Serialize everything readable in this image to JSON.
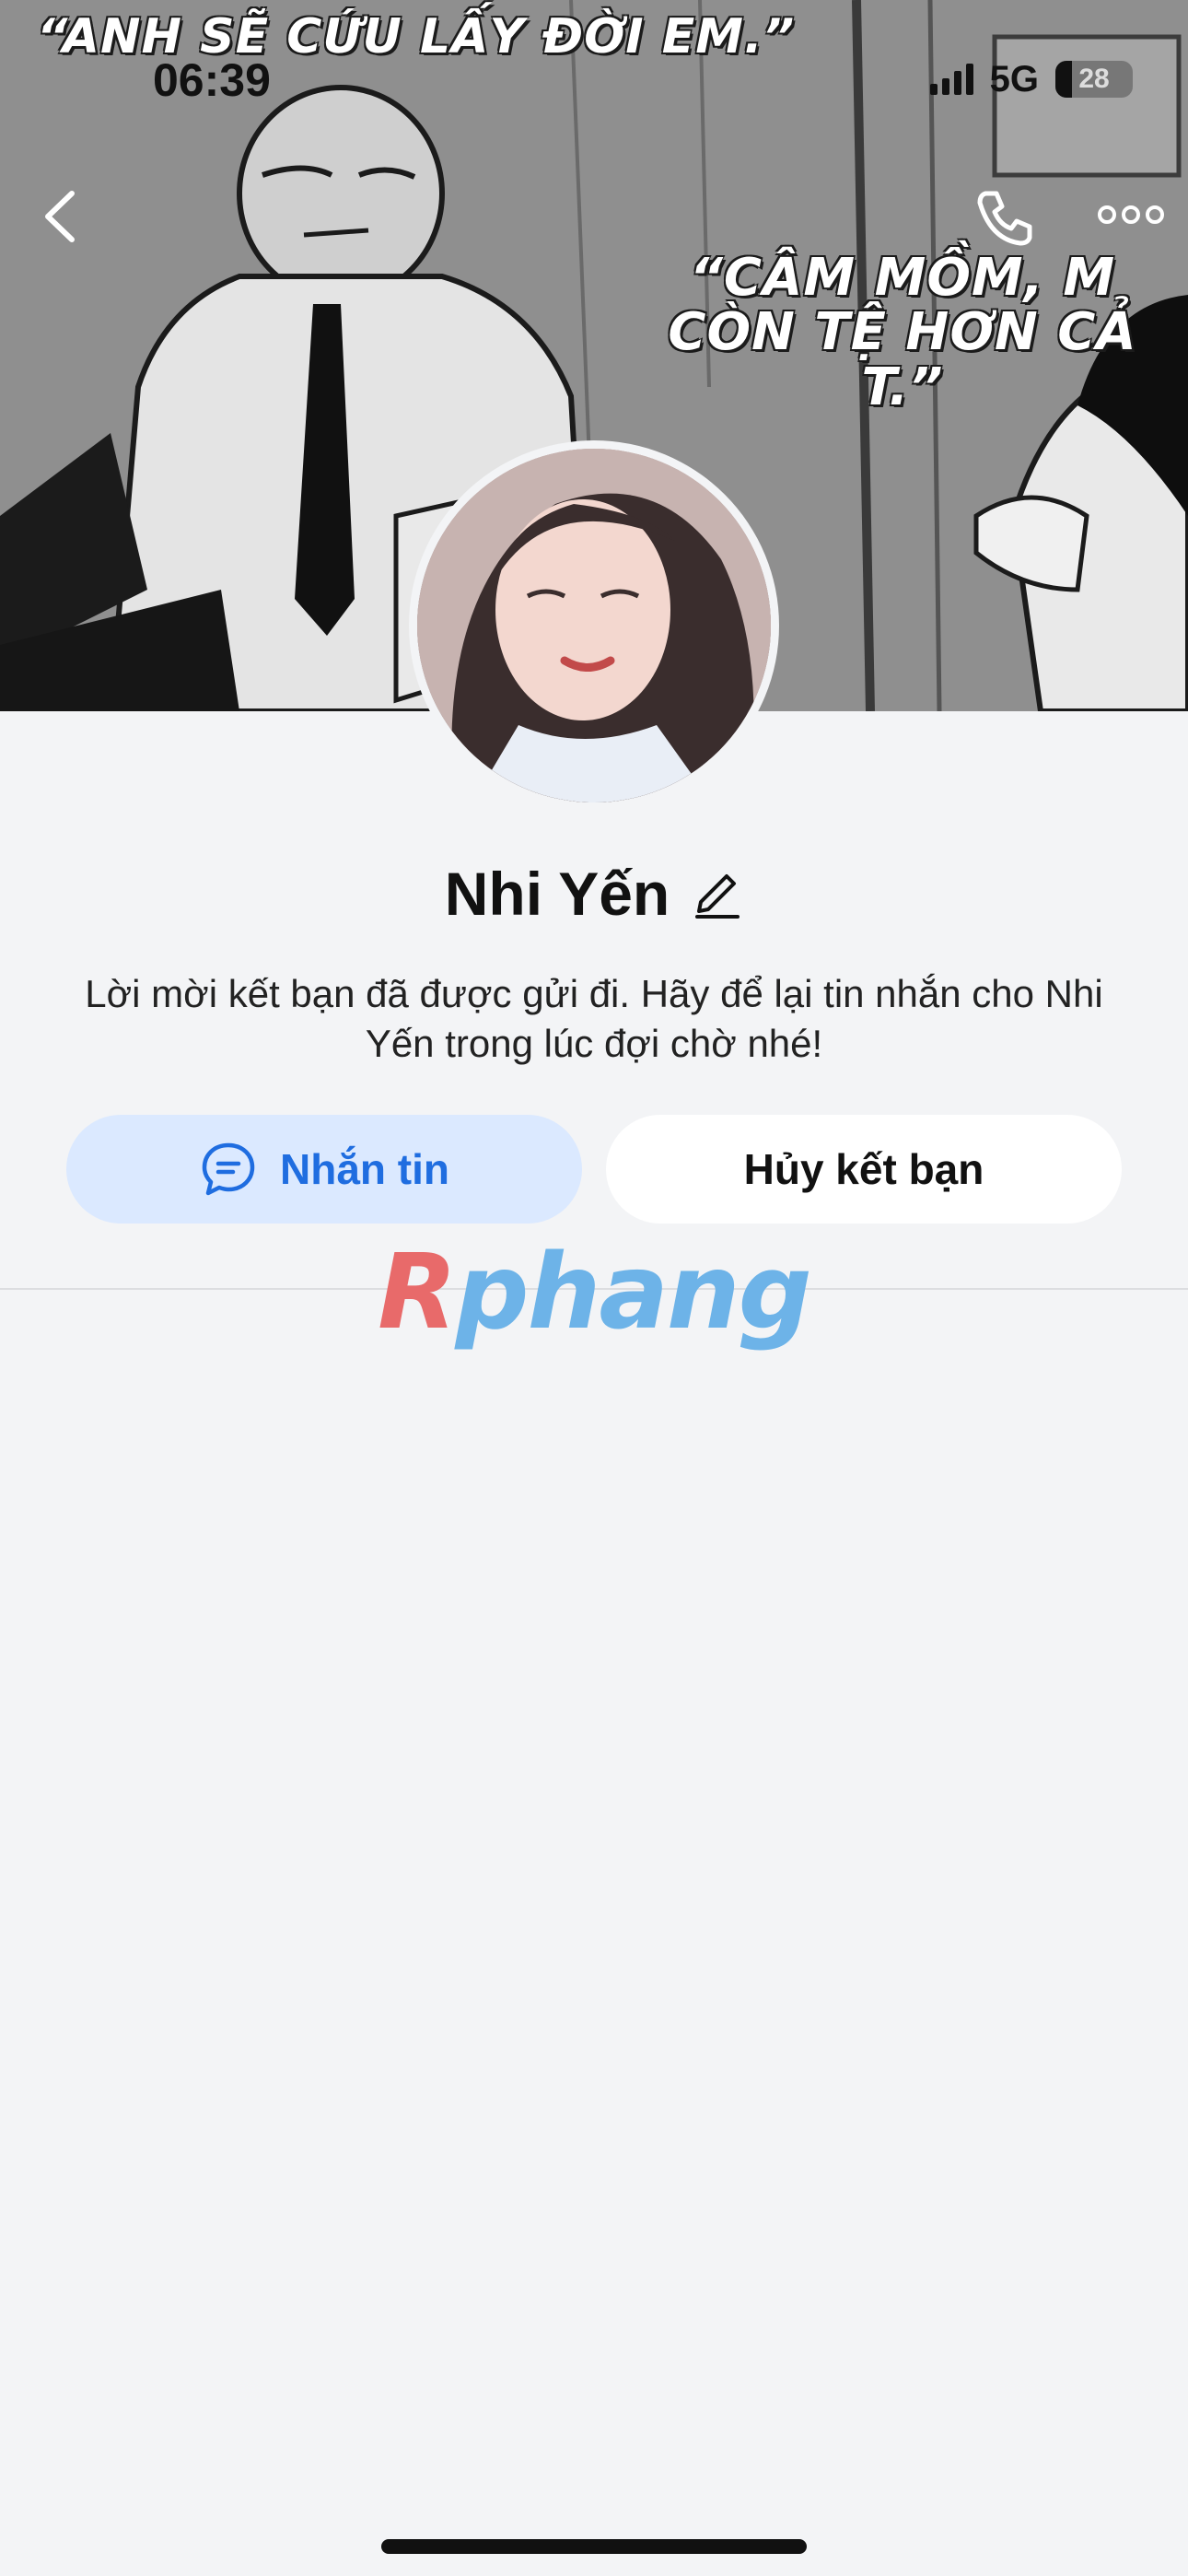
{
  "status_bar": {
    "time": "06:39",
    "network": "5G",
    "battery": "28"
  },
  "cover": {
    "quote_top": "“ANH SẼ CỨU LẤY ĐỜI EM.”",
    "quote_right": "“CÂM MỒM, M CÒN TỆ HƠN CẢ T.”"
  },
  "nav": {
    "back_icon": "chevron-left-icon",
    "call_icon": "phone-icon",
    "more_icon": "more-horizontal-icon"
  },
  "profile": {
    "name": "Nhi Yến",
    "edit_icon": "pencil-icon",
    "message": "Lời mời kết bạn đã được gửi đi. Hãy để lại tin nhắn cho Nhi Yến trong lúc đợi chờ nhé!"
  },
  "actions": {
    "message_label": "Nhắn tin",
    "message_icon": "chat-bubble-icon",
    "cancel_label": "Hủy kết bạn"
  },
  "watermark": {
    "first": "R",
    "rest": "phang"
  },
  "colors": {
    "accent": "#1f6de0",
    "accent_bg": "#dbe9ff",
    "page_bg": "#f3f4f6"
  }
}
